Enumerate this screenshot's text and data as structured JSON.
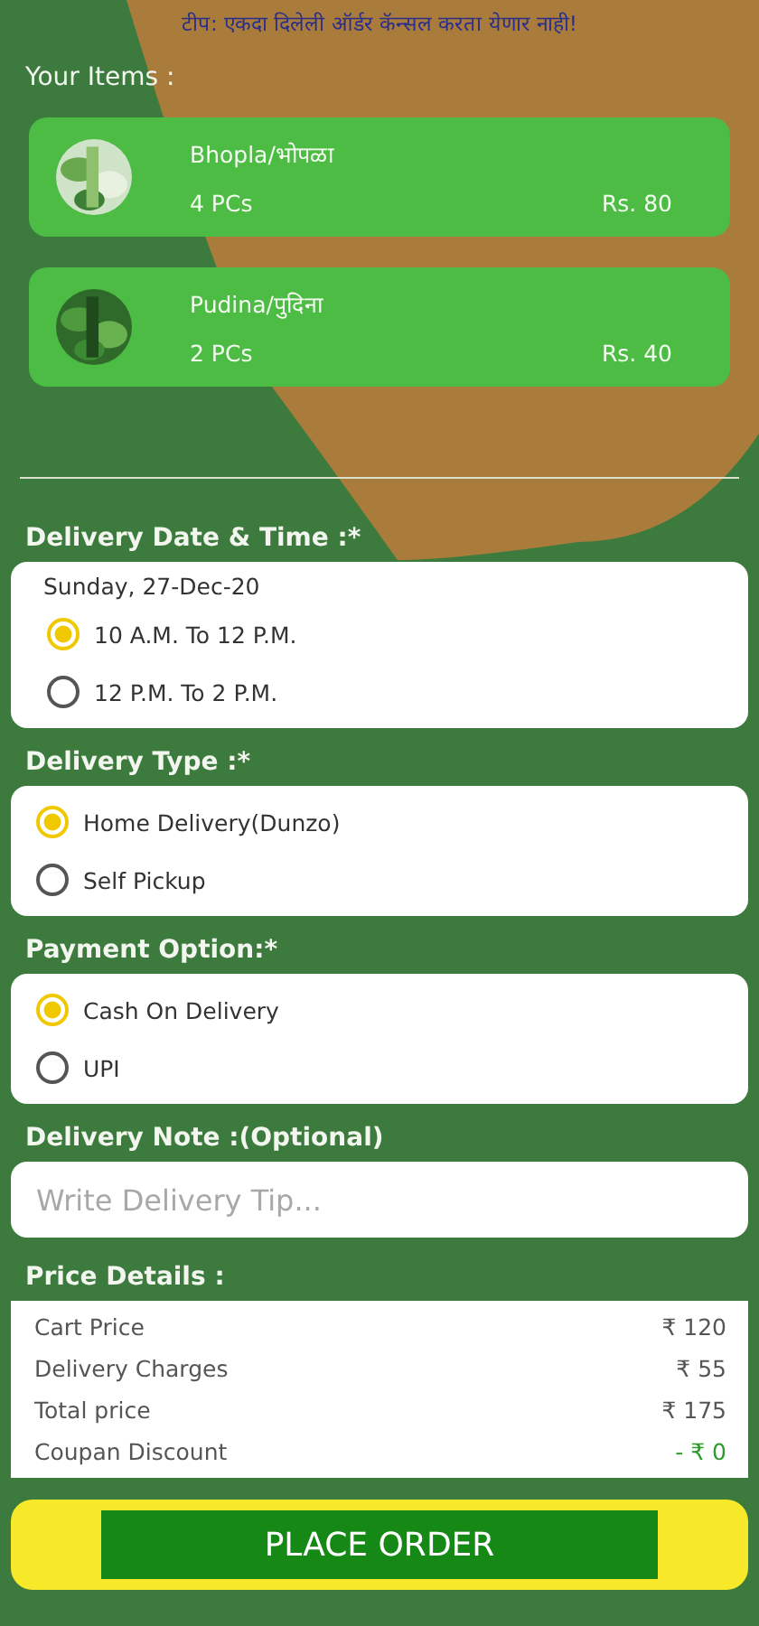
{
  "tip": "टीप: एकदा दिलेली ऑर्डर कॅन्सल करता येणार नाही!",
  "items_heading": "Your Items :",
  "items": [
    {
      "kind": "picture",
      "name": "Bhopla/भोपळा",
      "quantity": "4 PCs",
      "price": "Rs. 80"
    },
    {
      "kind": "picture",
      "name": "Pudina/पुदिना",
      "quantity": "2 PCs",
      "price": "Rs. 40"
    }
  ],
  "sections": [
    {
      "heading": "Delivery Date & Time :*",
      "date": "Sunday, 27-Dec-20",
      "options": [
        {
          "label": "10 A.M. To 12 P.M.",
          "selected": true
        },
        {
          "label": "12 P.M. To 2 P.M.",
          "selected": false
        }
      ]
    },
    {
      "heading": "Delivery Type :*",
      "options": [
        {
          "label": "Home Delivery(Dunzo)",
          "selected": true
        },
        {
          "label": "Self Pickup",
          "selected": false
        }
      ]
    },
    {
      "heading": "Payment Option:*",
      "options": [
        {
          "label": "Cash On Delivery",
          "selected": true
        },
        {
          "label": "UPI",
          "selected": false
        }
      ]
    }
  ],
  "note": {
    "heading": "Delivery Note :(Optional)",
    "placeholder": "Write Delivery Tip..."
  },
  "price_details": {
    "heading": "Price Details :",
    "rows": [
      {
        "kind": "charge",
        "label": "Cart Price",
        "value": "₹  120"
      },
      {
        "kind": "charge",
        "label": "Delivery Charges",
        "value": "₹ 55"
      },
      {
        "kind": "charge",
        "label": "Total price",
        "value": "₹ 175"
      },
      {
        "kind": "discount",
        "label": "Coupan Discount",
        "value": "- ₹ 0"
      }
    ]
  },
  "place_order": "PLACE ORDER"
}
